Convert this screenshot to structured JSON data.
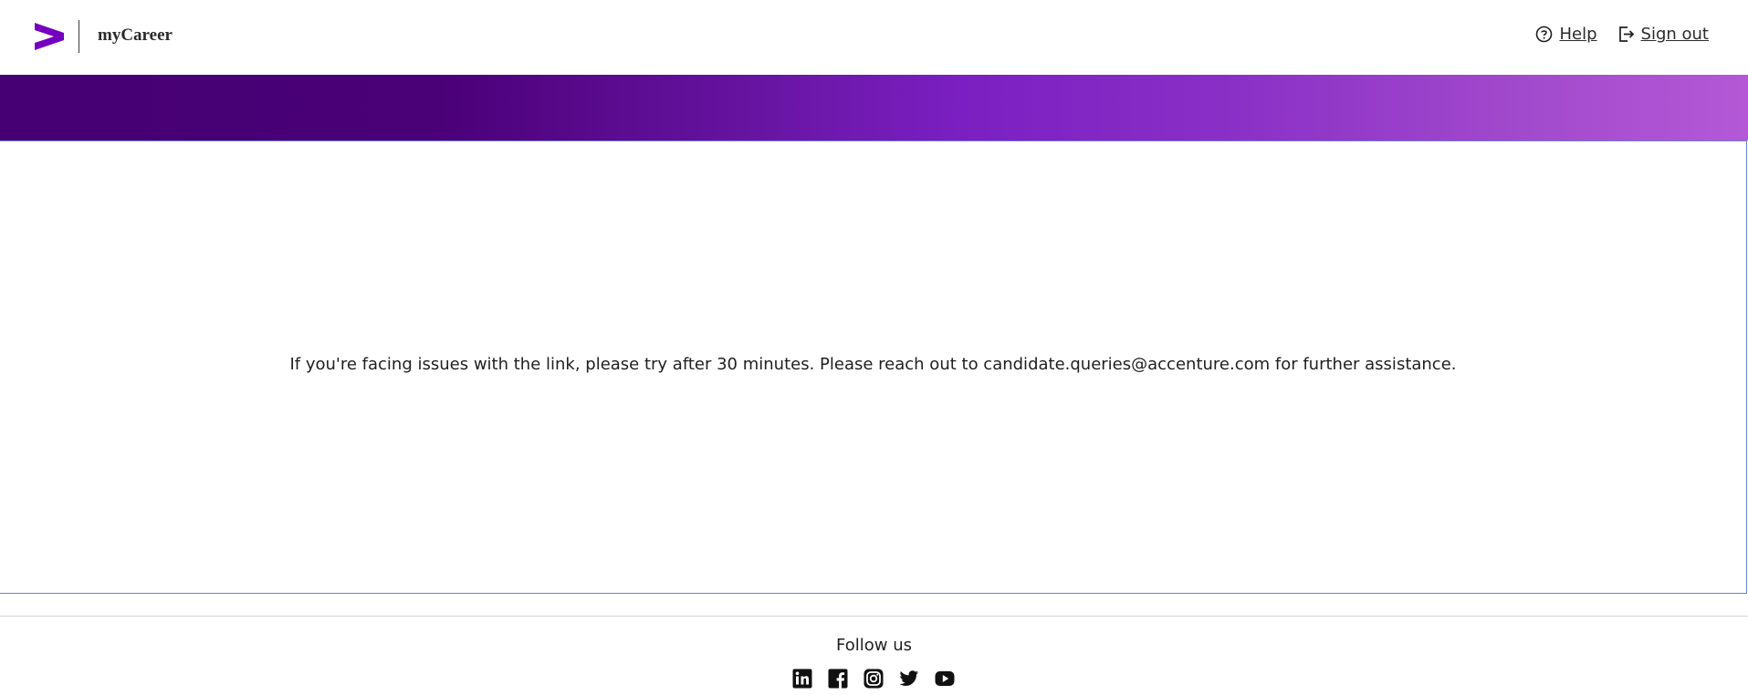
{
  "header": {
    "brand": "myCareer",
    "logo_icon": "accenture-greater-than-logo-icon",
    "help_label": "Help",
    "signout_label": "Sign out"
  },
  "main": {
    "message": "If you're facing issues with the link, please try after 30 minutes. Please reach out to candidate.queries@accenture.com for further assistance."
  },
  "footer": {
    "follow_label": "Follow us",
    "socials": [
      "linkedin-icon",
      "facebook-icon",
      "instagram-icon",
      "twitter-icon",
      "youtube-icon"
    ]
  },
  "colors": {
    "brand_purple": "#7500c0",
    "banner_start": "#460073",
    "banner_end": "#b458d6",
    "frame_border": "#6b7fd7"
  }
}
